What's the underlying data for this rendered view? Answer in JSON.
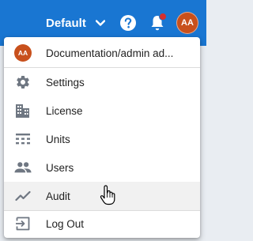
{
  "header": {
    "environment": "Default",
    "avatar_initials": "AA",
    "accent_color": "#1976d2",
    "avatar_color": "#c8501c",
    "notification_dot_color": "#d32f2f"
  },
  "menu": {
    "profile": {
      "initials": "AA",
      "label": "Documentation/admin ad..."
    },
    "items": [
      {
        "label": "Settings",
        "icon": "gear-icon"
      },
      {
        "label": "License",
        "icon": "building-icon"
      },
      {
        "label": "Units",
        "icon": "units-icon"
      },
      {
        "label": "Users",
        "icon": "users-icon"
      },
      {
        "label": "Audit",
        "icon": "trending-line-icon"
      }
    ],
    "logout": {
      "label": "Log Out",
      "icon": "logout-icon"
    }
  }
}
